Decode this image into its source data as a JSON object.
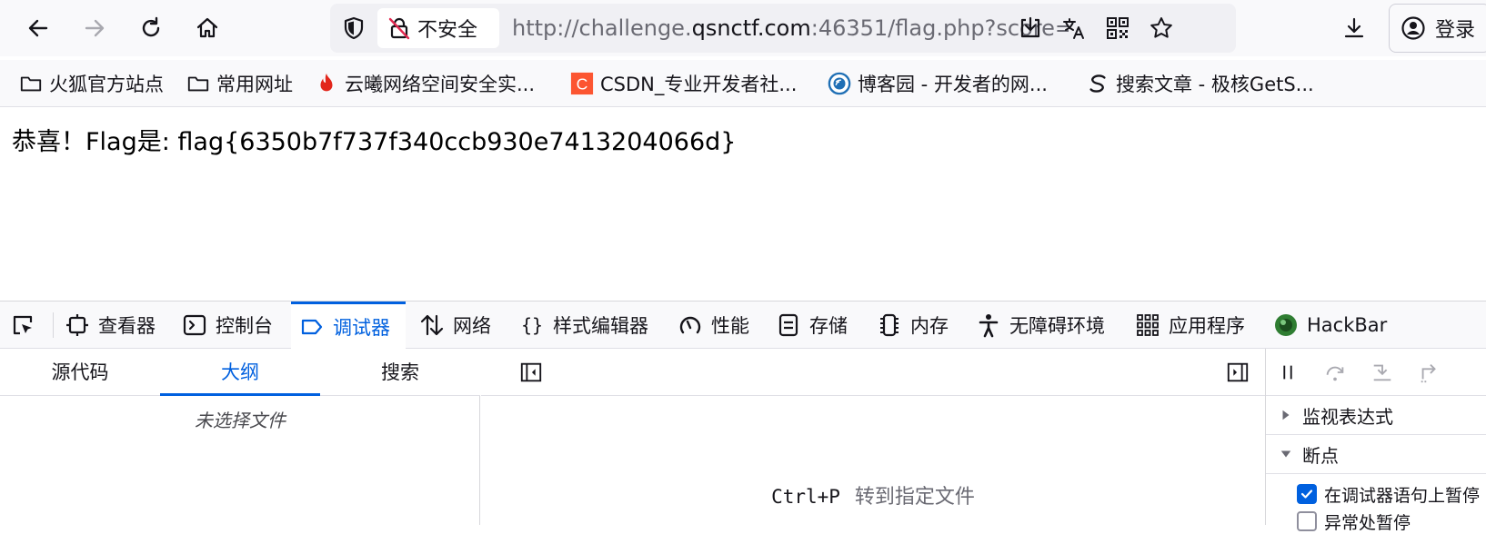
{
  "browser": {
    "url_prefix": "http://challenge.",
    "url_domain": "qsnctf.com",
    "url_suffix": ":46351/flag.php?score=",
    "security_label": "不安全",
    "login_label": "登录",
    "accent_color": "#0060df"
  },
  "bookmarks": [
    {
      "label": "火狐官方站点",
      "icon": "folder-icon"
    },
    {
      "label": "常用网址",
      "icon": "folder-icon"
    },
    {
      "label": "云曦网络空间安全实...",
      "icon": "flame-icon"
    },
    {
      "label": "CSDN_专业开发者社...",
      "icon": "csdn-icon"
    },
    {
      "label": "博客园 - 开发者的网...",
      "icon": "cnblogs-icon"
    },
    {
      "label": "搜索文章 - 极核GetS...",
      "icon": "getshell-icon"
    }
  ],
  "page": {
    "flag_text": "恭喜！Flag是: flag{6350b7f737f340ccb930e7413204066d}"
  },
  "devtools": {
    "tabs": [
      {
        "label": "查看器",
        "icon": "inspector-icon"
      },
      {
        "label": "控制台",
        "icon": "console-icon"
      },
      {
        "label": "调试器",
        "icon": "debugger-icon"
      },
      {
        "label": "网络",
        "icon": "network-icon"
      },
      {
        "label": "样式编辑器",
        "icon": "style-editor-icon"
      },
      {
        "label": "性能",
        "icon": "performance-icon"
      },
      {
        "label": "存储",
        "icon": "storage-icon"
      },
      {
        "label": "内存",
        "icon": "memory-icon"
      },
      {
        "label": "无障碍环境",
        "icon": "accessibility-icon"
      },
      {
        "label": "应用程序",
        "icon": "application-icon"
      },
      {
        "label": "HackBar",
        "icon": "hackbar-icon"
      }
    ],
    "active_tab": "调试器",
    "sources_tabs": [
      "源代码",
      "大纲",
      "搜索"
    ],
    "active_sources_tab": "大纲",
    "no_file_text": "未选择文件",
    "shortcut_key": "Ctrl+P",
    "shortcut_desc": "转到指定文件",
    "watch_label": "监视表达式",
    "breakpoints_label": "断点",
    "pause_on_debugger_label": "在调试器语句上暂停",
    "pause_on_debugger_checked": true,
    "pause_on_exceptions_label": "异常处暂停",
    "pause_on_exceptions_checked": false
  }
}
